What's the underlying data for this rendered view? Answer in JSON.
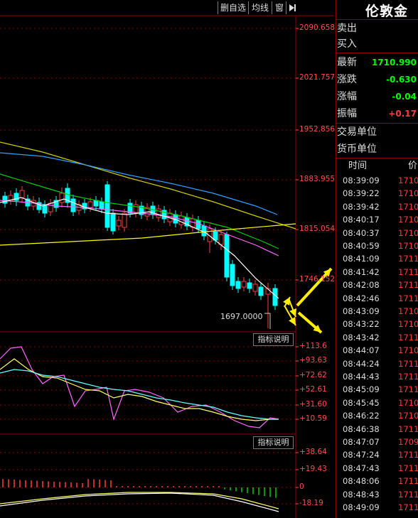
{
  "toolbar": {
    "delete_label": "删自选",
    "ma_label": "均线",
    "window_label": "窗",
    "collapse_icon": "collapse-right-icon"
  },
  "instrument": {
    "name": "伦敦金"
  },
  "quote": {
    "sell_label": "卖出",
    "buy_label": "买入",
    "latest_label": "最新",
    "latest_value": "1710.990",
    "change_label": "涨跌",
    "change_value": "-0.630",
    "change_pct_label": "涨幅",
    "change_pct_value": "-0.04",
    "amplitude_label": "振幅",
    "amplitude_value": "+0.17",
    "trade_unit_label": "交易单位",
    "currency_unit_label": "货币单位"
  },
  "ticks": {
    "header_time": "时间",
    "header_price": "价",
    "rows": [
      {
        "time": "08:39:09",
        "price": "1710"
      },
      {
        "time": "08:39:22",
        "price": "1710"
      },
      {
        "time": "08:39:42",
        "price": "1710"
      },
      {
        "time": "08:40:17",
        "price": "1710"
      },
      {
        "time": "08:40:37",
        "price": "1710"
      },
      {
        "time": "08:40:59",
        "price": "1710"
      },
      {
        "time": "08:41:09",
        "price": "1711"
      },
      {
        "time": "08:41:42",
        "price": "1711"
      },
      {
        "time": "08:42:08",
        "price": "1711"
      },
      {
        "time": "08:42:46",
        "price": "1711"
      },
      {
        "time": "08:43:09",
        "price": "1710"
      },
      {
        "time": "08:43:22",
        "price": "1710"
      },
      {
        "time": "08:43:42",
        "price": "1711"
      },
      {
        "time": "08:44:07",
        "price": "1710"
      },
      {
        "time": "08:44:24",
        "price": "1711"
      },
      {
        "time": "08:44:43",
        "price": "1711"
      },
      {
        "time": "08:45:09",
        "price": "1711"
      },
      {
        "time": "08:45:45",
        "price": "1710"
      },
      {
        "time": "08:46:22",
        "price": "1710"
      },
      {
        "time": "08:46:38",
        "price": "1711"
      },
      {
        "time": "08:47:07",
        "price": "1709"
      },
      {
        "time": "08:47:24",
        "price": "1711"
      },
      {
        "time": "08:47:43",
        "price": "1711"
      },
      {
        "time": "08:48:06",
        "price": "1711"
      },
      {
        "time": "08:48:43",
        "price": "1711"
      },
      {
        "time": "08:49:09",
        "price": "1711"
      }
    ]
  },
  "colors": {
    "up": "#ff3b3b",
    "down": "#00ffff",
    "ma1": "#ffffff",
    "ma2": "#ffff00",
    "ma3": "#ff66ff",
    "ma4": "#00cc00",
    "ma5": "#2f9fff",
    "long_line": "#cccc00",
    "arrow": "#ffee00",
    "tick_price": "#ff3b3b",
    "latest": "#00ff00"
  },
  "chart_data": [
    {
      "type": "candlestick",
      "y_ticks": [
        "2090.658",
        "2021.757",
        "1952.856",
        "1883.955",
        "1815.054",
        "1746.152"
      ],
      "ylim": [
        1697,
        2090.658
      ],
      "min_marker": "1697.0000",
      "indicator_button": "指标说明"
    },
    {
      "type": "line",
      "y_ticks": [
        "+113.6",
        "+93.63",
        "+72.62",
        "+52.61",
        "+31.60",
        "+10.59"
      ],
      "indicator_button": "指标说明"
    },
    {
      "type": "bar",
      "y_ticks": [
        "+38.64",
        "+19.43",
        "0",
        "-18.19"
      ]
    }
  ]
}
